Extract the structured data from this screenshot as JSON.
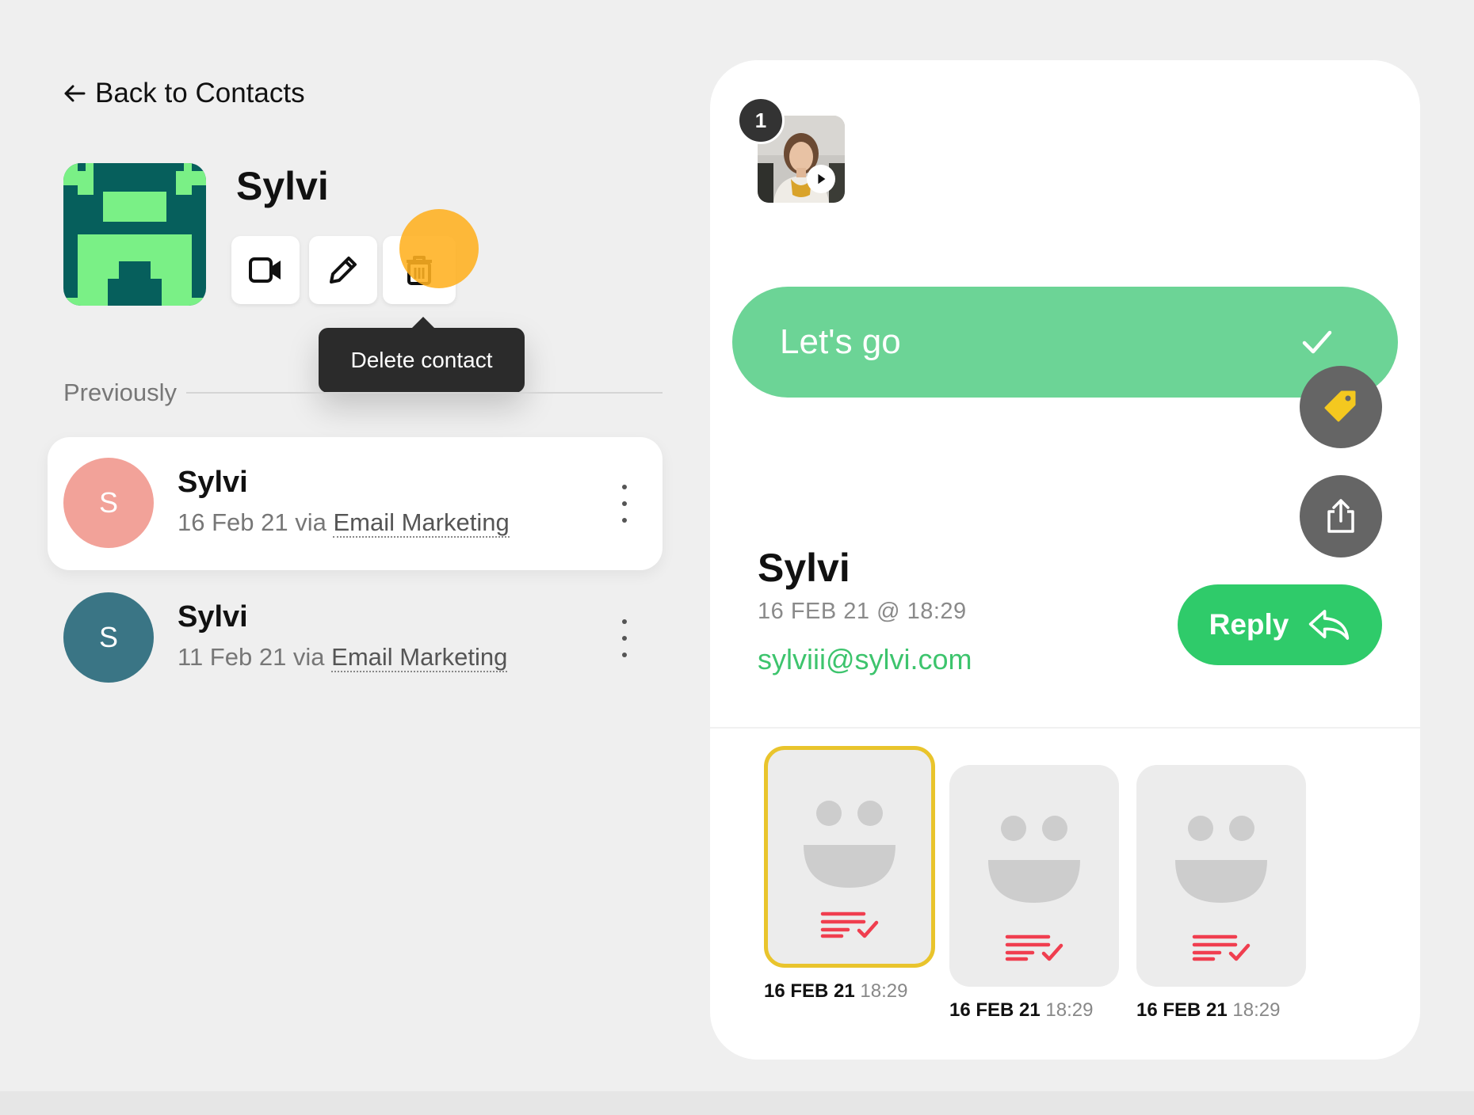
{
  "left": {
    "back_label": "Back to Contacts",
    "contact": {
      "name": "Sylvi"
    },
    "actions": {
      "video_icon": "video-camera-icon",
      "edit_icon": "pencil-icon",
      "delete_icon": "trash-icon"
    },
    "tooltip": "Delete contact",
    "previously_label": "Previously",
    "history": [
      {
        "initial": "S",
        "name": "Sylvi",
        "meta_prefix": "16 Feb 21 via",
        "source": "Email Marketing",
        "avatar_color": "#f2a299"
      },
      {
        "initial": "S",
        "name": "Sylvi",
        "meta_prefix": "11 Feb 21 via",
        "source": "Email Marketing",
        "avatar_color": "#3a7585"
      }
    ]
  },
  "right": {
    "video_count": "1",
    "cta_label": "Let's go",
    "sender": {
      "name": "Sylvi",
      "time": "16 FEB 21 @ 18:29",
      "email": "sylviii@sylvi.com"
    },
    "reply_label": "Reply",
    "messages": [
      {
        "date": "16 FEB 21",
        "time": "18:29",
        "selected": true
      },
      {
        "date": "16 FEB 21",
        "time": "18:29",
        "selected": false
      },
      {
        "date": "16 FEB 21",
        "time": "18:29",
        "selected": false
      }
    ]
  },
  "colors": {
    "accent_green": "#2fcb6a",
    "cta_green": "#6cd496",
    "highlight_yellow": "#e9c42c",
    "status_red": "#f03e4f",
    "tooltip_bg": "#2b2b2b"
  }
}
